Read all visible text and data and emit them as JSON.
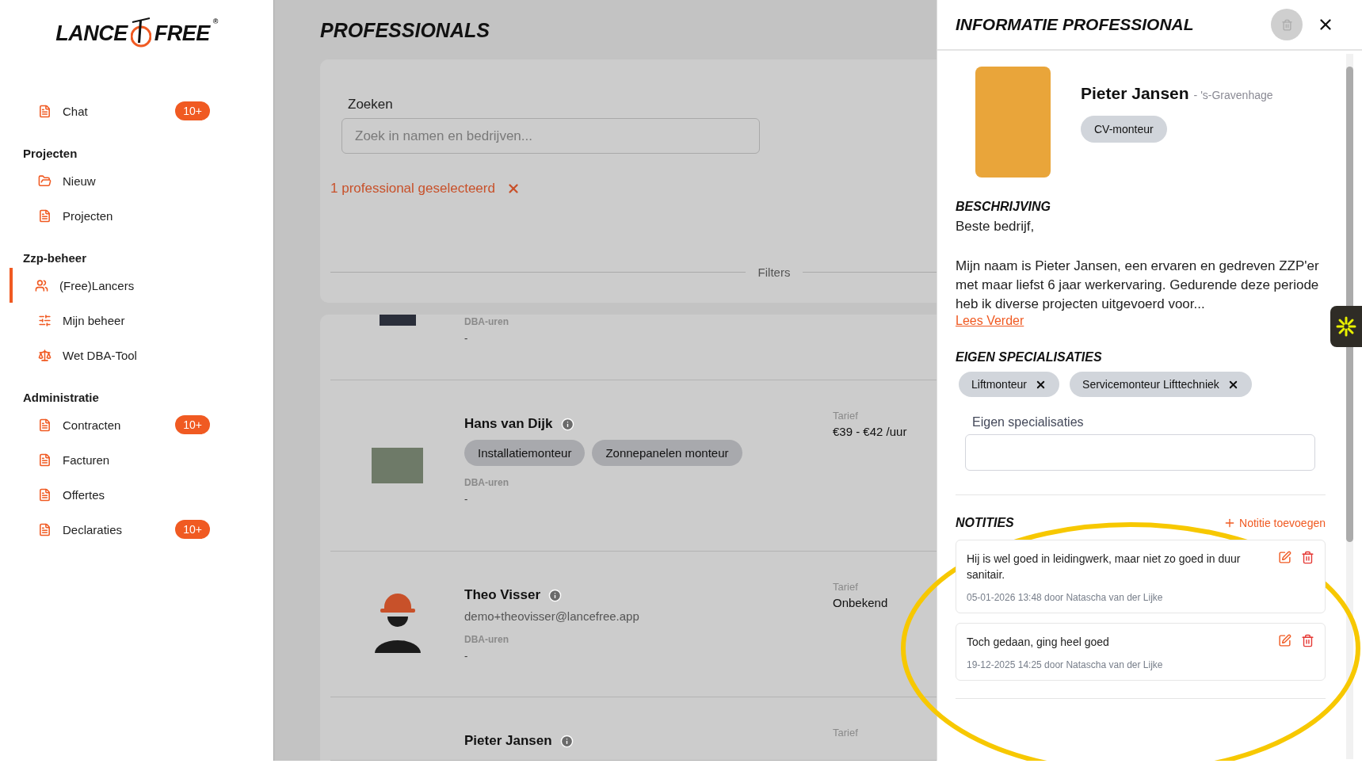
{
  "brand": {
    "left": "LANCE",
    "right": "FREE",
    "mark": "®"
  },
  "sidebar": {
    "sections": [
      {
        "items": [
          {
            "label": "Chat",
            "kind": "document",
            "badge": "10+",
            "selected": false
          }
        ]
      },
      {
        "heading": "Projecten",
        "items": [
          {
            "label": "Nieuw",
            "kind": "folder",
            "selected": false
          },
          {
            "label": "Projecten",
            "kind": "document",
            "selected": false
          }
        ]
      },
      {
        "heading": "Zzp-beheer",
        "items": [
          {
            "label": "(Free)Lancers",
            "kind": "people",
            "selected": true
          },
          {
            "label": "Mijn beheer",
            "kind": "sliders",
            "selected": false
          },
          {
            "label": "Wet DBA-Tool",
            "kind": "scale",
            "selected": false
          }
        ]
      },
      {
        "heading": "Administratie",
        "items": [
          {
            "label": "Contracten",
            "kind": "document",
            "badge": "10+",
            "selected": false
          },
          {
            "label": "Facturen",
            "kind": "document",
            "selected": false
          },
          {
            "label": "Offertes",
            "kind": "document",
            "selected": false
          },
          {
            "label": "Declaraties",
            "kind": "document",
            "badge": "10+",
            "selected": false
          }
        ]
      }
    ]
  },
  "main": {
    "title": "PROFESSIONALS",
    "search": {
      "label": "Zoeken",
      "placeholder": "Zoek in namen en bedrijven..."
    },
    "selection": "1 professional geselecteerd",
    "filters_label": "Filters",
    "rows": [
      {
        "kind": "partial",
        "dba_label": "DBA-uren",
        "dba_value": "-"
      },
      {
        "kind": "photo",
        "name": "Hans van Dijk",
        "tags": [
          "Installatiemonteur",
          "Zonnepanelen monteur"
        ],
        "dba_label": "DBA-uren",
        "dba_value": "-",
        "rate_label": "Tarief",
        "rate_value": "€39 - €42 /uur"
      },
      {
        "kind": "silhouette",
        "name": "Theo Visser",
        "email": "demo+theovisser@lancefree.app",
        "dba_label": "DBA-uren",
        "dba_value": "-",
        "rate_label": "Tarief",
        "rate_value": "Onbekend"
      },
      {
        "kind": "none",
        "name": "Pieter Jansen",
        "rate_label": "Tarief"
      }
    ]
  },
  "panel": {
    "title": "INFORMATIE PROFESSIONAL",
    "delete_disabled": true,
    "profile": {
      "name": "Pieter Jansen",
      "city": "- 's-Gravenhage",
      "tag": "CV-monteur"
    },
    "description": {
      "heading": "BESCHRIJVING",
      "paragraphs": [
        "Beste bedrijf,",
        "Mijn naam is Pieter Jansen, een ervaren en gedreven ZZP'er met maar liefst 6 jaar werkervaring. Gedurende deze periode heb ik diverse projecten uitgevoerd voor..."
      ],
      "link": "Lees Verder"
    },
    "specializations": {
      "heading": "EIGEN SPECIALISATIES",
      "chips": [
        "Liftmonteur",
        "Servicemonteur Lifttechniek"
      ],
      "field_label": "Eigen specialisaties"
    },
    "notes": {
      "heading": "NOTITIES",
      "add": "Notitie toevoegen",
      "items": [
        {
          "text": "Hij is wel goed in leidingwerk, maar niet zo goed in duur sanitair.",
          "meta": "05-01-2026 13:48 door Natascha van der Lijke"
        },
        {
          "text": "Toch gedaan, ging heel goed",
          "meta": "19-12-2025 14:25 door Natascha van der Lijke"
        }
      ]
    }
  }
}
